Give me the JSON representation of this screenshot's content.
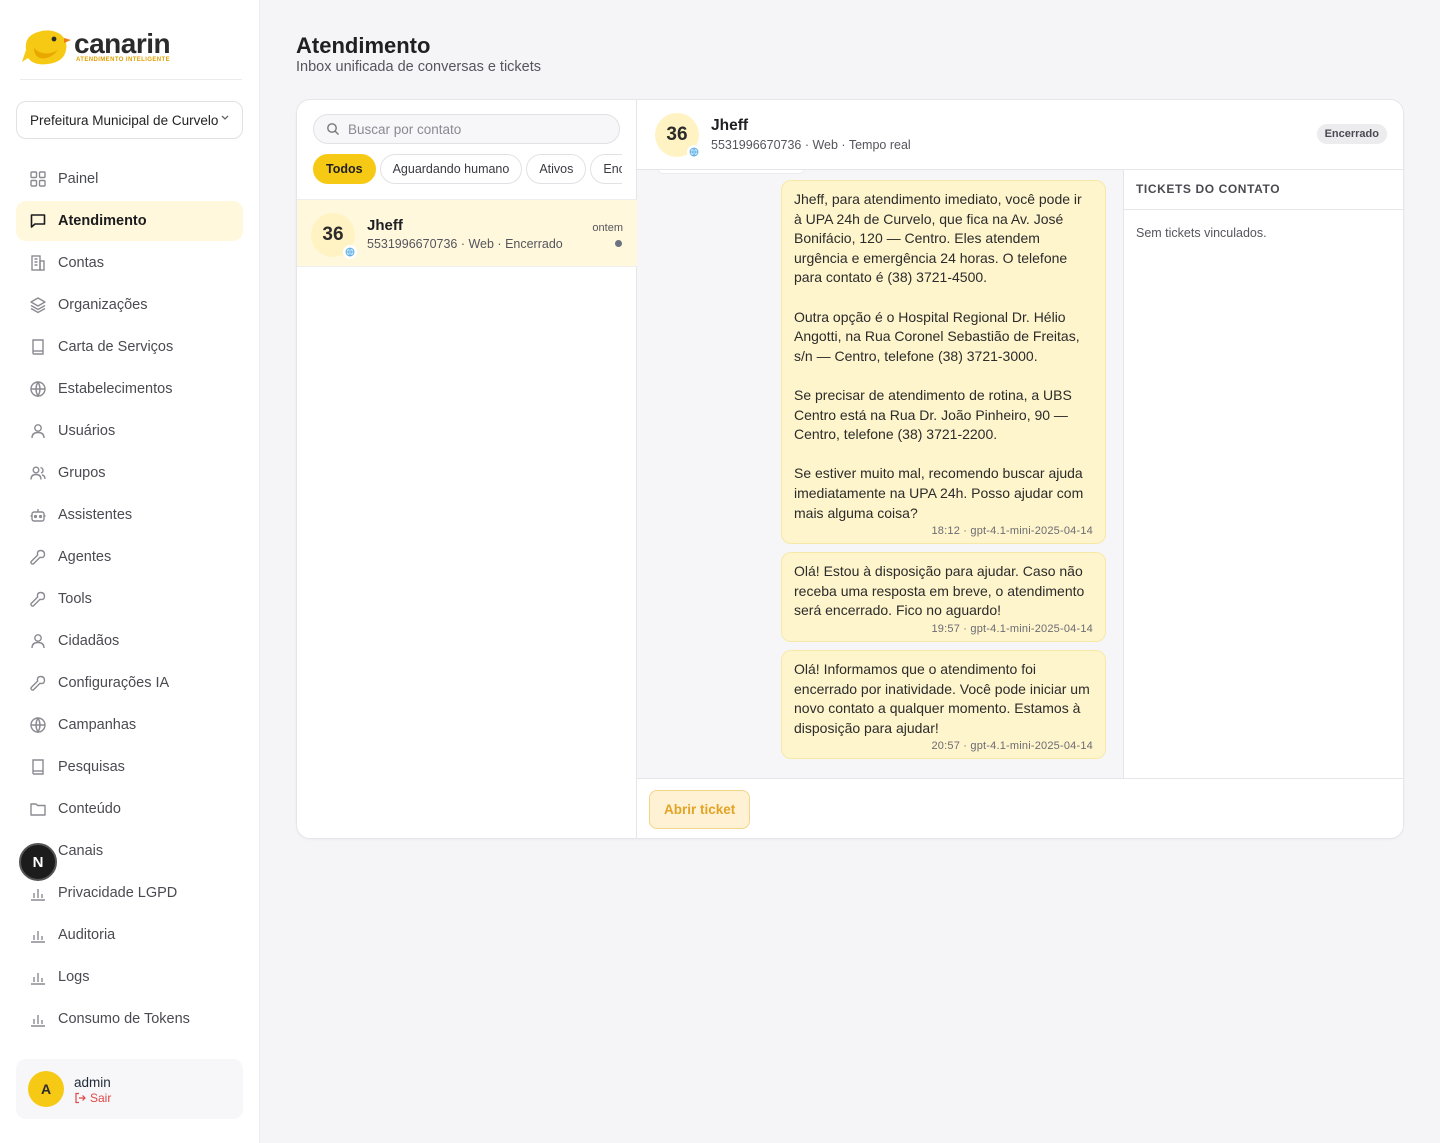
{
  "brand": {
    "name": "canarin",
    "tagline": "ATENDIMENTO INTELIGENTE",
    "accent": "#f6c915"
  },
  "org_selector": {
    "value": "Prefeitura Municipal de Curvelo"
  },
  "nav": [
    {
      "label": "Painel",
      "icon": "grid-icon",
      "active": false
    },
    {
      "label": "Atendimento",
      "icon": "chat-icon",
      "active": true
    },
    {
      "label": "Contas",
      "icon": "building-icon",
      "active": false
    },
    {
      "label": "Organizações",
      "icon": "layers-icon",
      "active": false
    },
    {
      "label": "Carta de Serviços",
      "icon": "book-icon",
      "active": false
    },
    {
      "label": "Estabelecimentos",
      "icon": "globe-icon",
      "active": false
    },
    {
      "label": "Usuários",
      "icon": "user-icon",
      "active": false
    },
    {
      "label": "Grupos",
      "icon": "users-icon",
      "active": false
    },
    {
      "label": "Assistentes",
      "icon": "bot-icon",
      "active": false
    },
    {
      "label": "Agentes",
      "icon": "wrench-icon",
      "active": false
    },
    {
      "label": "Tools",
      "icon": "wrench-icon",
      "active": false
    },
    {
      "label": "Cidadãos",
      "icon": "user-icon",
      "active": false
    },
    {
      "label": "Configurações IA",
      "icon": "wrench-icon",
      "active": false
    },
    {
      "label": "Campanhas",
      "icon": "globe-icon",
      "active": false
    },
    {
      "label": "Pesquisas",
      "icon": "book-icon",
      "active": false
    },
    {
      "label": "Conteúdo",
      "icon": "folder-icon",
      "active": false
    },
    {
      "label": "Canais",
      "icon": "bar-chart-icon",
      "active": false
    },
    {
      "label": "Privacidade LGPD",
      "icon": "bar-chart-icon",
      "active": false
    },
    {
      "label": "Auditoria",
      "icon": "bar-chart-icon",
      "active": false
    },
    {
      "label": "Logs",
      "icon": "bar-chart-icon",
      "active": false
    },
    {
      "label": "Consumo de Tokens",
      "icon": "bar-chart-icon",
      "active": false
    }
  ],
  "dev_badge": {
    "letter": "N"
  },
  "user": {
    "initial": "A",
    "name": "admin",
    "logout_label": "Sair"
  },
  "header": {
    "title": "Atendimento",
    "subtitle": "Inbox unificada de conversas e tickets"
  },
  "search": {
    "placeholder": "Buscar por contato"
  },
  "filters": [
    {
      "label": "Todos",
      "active": true
    },
    {
      "label": "Aguardando humano",
      "active": false
    },
    {
      "label": "Ativos",
      "active": false
    },
    {
      "label": "Encerrados",
      "active": false
    }
  ],
  "conversations": [
    {
      "avatar": "36",
      "name": "Jheff",
      "meta": "5531996670736 · Web · Encerrado",
      "time": "ontem"
    }
  ],
  "chat": {
    "avatar": "36",
    "name": "Jheff",
    "meta": "5531996670736  ·  Web  ·  Tempo real",
    "status": "Encerrado",
    "messages": [
      {
        "text": "Jheff, para atendimento imediato, você pode ir à UPA 24h de Curvelo, que fica na Av. José Bonifácio, 120 — Centro. Eles atendem urgência e emergência 24 horas. O telefone para contato é (38) 3721-4500.\n\nOutra opção é o Hospital Regional Dr. Hélio Angotti, na Rua Coronel Sebastião de Freitas, s/n — Centro, telefone (38) 3721-3000.\n\nSe precisar de atendimento de rotina, a UBS Centro está na Rua Dr. João Pinheiro, 90 — Centro, telefone (38) 3721-2200.\n\nSe estiver muito mal, recomendo buscar ajuda imediatamente na UPA 24h. Posso ajudar com mais alguma coisa?",
        "stamp": "18:12 · gpt-4.1-mini-2025-04-14"
      },
      {
        "text": "Olá! Estou à disposição para ajudar. Caso não receba uma resposta em breve, o atendimento será encerrado. Fico no aguardo!",
        "stamp": "19:57 · gpt-4.1-mini-2025-04-14"
      },
      {
        "text": "Olá! Informamos que o atendimento foi encerrado por inatividade. Você pode iniciar um novo contato a qualquer momento. Estamos à disposição para ajudar!",
        "stamp": "20:57 · gpt-4.1-mini-2025-04-14"
      }
    ],
    "open_ticket_label": "Abrir ticket"
  },
  "tickets": {
    "title": "TICKETS DO CONTATO",
    "empty": "Sem tickets vinculados."
  }
}
